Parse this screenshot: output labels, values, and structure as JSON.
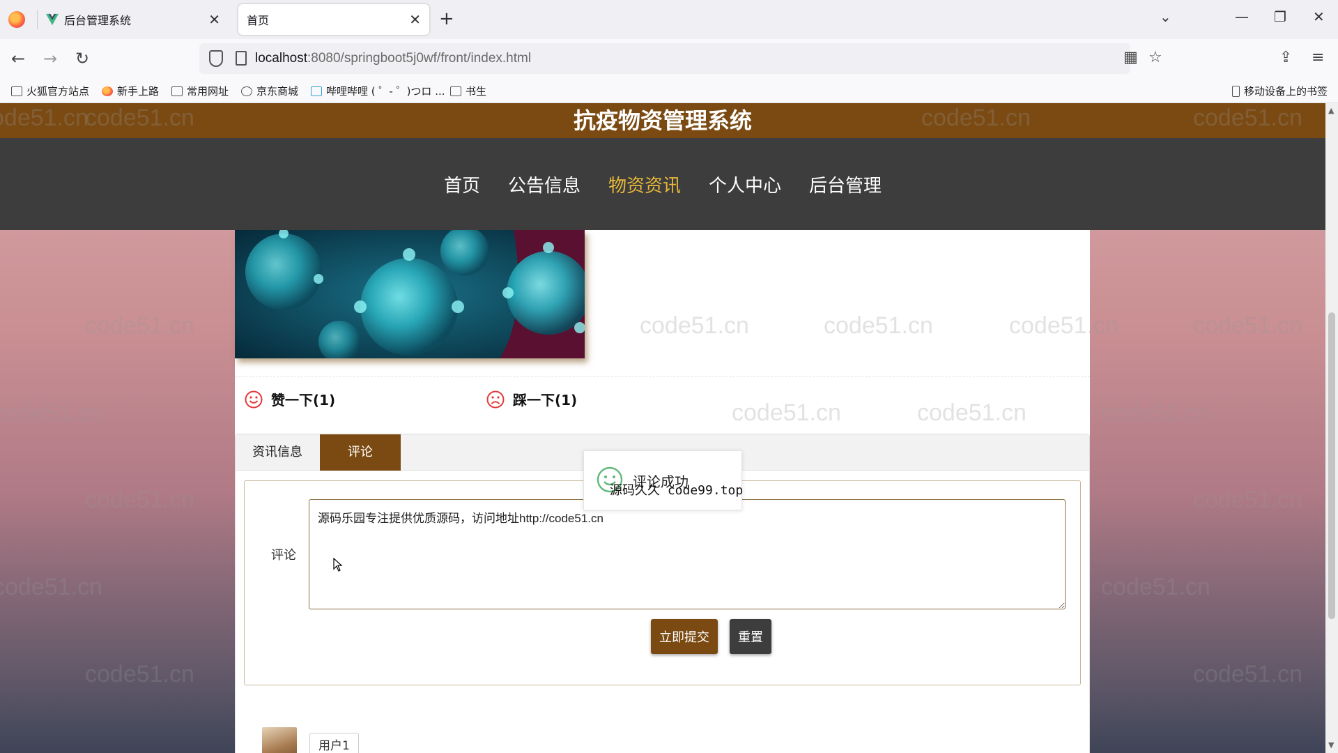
{
  "browser": {
    "tabs": [
      {
        "title": "后台管理系统",
        "active": false
      },
      {
        "title": "首页",
        "active": true
      }
    ],
    "url_host": "localhost",
    "url_path": ":8080/springboot5j0wf/front/index.html",
    "bookmarks": [
      "火狐官方站点",
      "新手上路",
      "常用网址",
      "京东商城",
      "哔哩哔哩 ( ゜- ゜)つロ ...",
      "书生"
    ],
    "mobile_bookmarks": "移动设备上的书签"
  },
  "site": {
    "title": "抗疫物资管理系统",
    "nav": [
      {
        "label": "首页",
        "active": false
      },
      {
        "label": "公告信息",
        "active": false
      },
      {
        "label": "物资资讯",
        "active": true
      },
      {
        "label": "个人中心",
        "active": false
      },
      {
        "label": "后台管理",
        "active": false
      }
    ],
    "accent_color": "#7a4a12",
    "active_nav_color": "#e8b83a"
  },
  "article": {
    "like_label": "赞一下(1)",
    "dislike_label": "踩一下(1)"
  },
  "tabs": {
    "info": "资讯信息",
    "comment": "评论"
  },
  "comment_form": {
    "label": "评论",
    "value": "源码乐园专注提供优质源码，访问地址http://code51.cn",
    "submit": "立即提交",
    "reset": "重置"
  },
  "comments": [
    {
      "user": "用户1"
    }
  ],
  "toast": {
    "message": "评论成功",
    "overlay": "源码久久 code99.top"
  },
  "watermark": "code51.cn"
}
